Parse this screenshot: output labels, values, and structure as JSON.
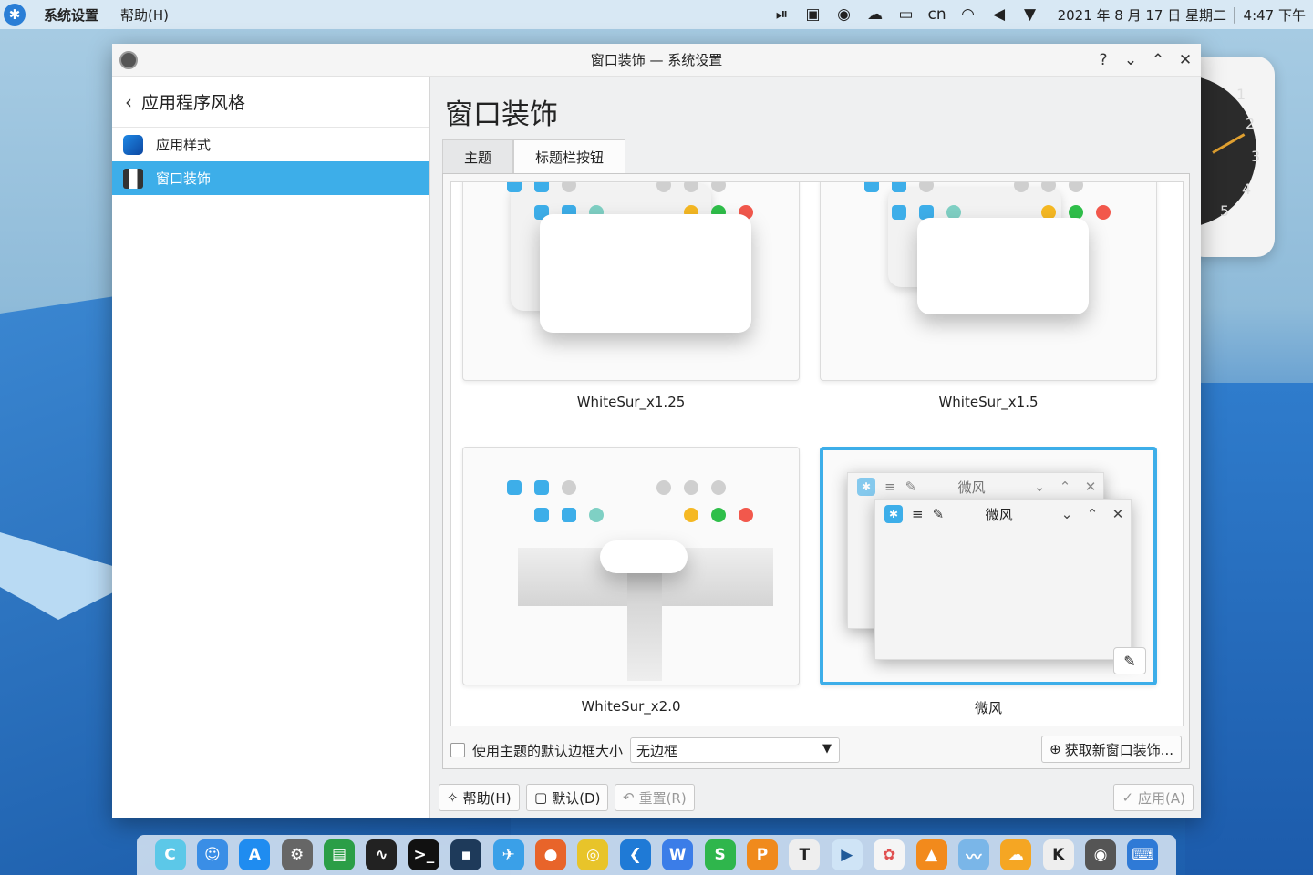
{
  "topbar": {
    "app_name": "系统设置",
    "menu_help": "帮助(H)",
    "lang": "cn",
    "clock": "2021 年 8 月 17 日 星期二 │ 4:47 下午"
  },
  "clock_widget": {
    "numbers": [
      "1",
      "2",
      "3",
      "4",
      "5"
    ]
  },
  "window": {
    "title": "窗口装饰 — 系统设置",
    "help_btn": "?",
    "min_btn": "⌄",
    "max_btn": "⌃",
    "close_btn": "✕"
  },
  "sidebar": {
    "back_label": "应用程序风格",
    "items": [
      {
        "label": "应用样式",
        "active": false
      },
      {
        "label": "窗口装饰",
        "active": true
      }
    ]
  },
  "main": {
    "page_title": "窗口装饰",
    "tabs": [
      {
        "label": "主题",
        "active": false
      },
      {
        "label": "标题栏按钮",
        "active": true
      }
    ],
    "themes": [
      {
        "name": "WhiteSur_x1.25",
        "selected": false
      },
      {
        "name": "WhiteSur_x1.5",
        "selected": false
      },
      {
        "name": "WhiteSur_x2.0",
        "selected": false
      },
      {
        "name": "微风",
        "selected": true
      }
    ],
    "breeze_preview_title": "微风",
    "border_checkbox_label": "使用主题的默认边框大小",
    "border_size_value": "无边框",
    "get_new_label": "获取新窗口装饰..."
  },
  "bottom_buttons": {
    "help": "帮助(H)",
    "defaults": "默认(D)",
    "reset": "重置(R)",
    "apply": "应用(A)"
  },
  "dock": {
    "items": [
      "launcher",
      "finder",
      "app-store",
      "system-settings",
      "task-manager",
      "system-monitor",
      "terminal",
      "konsole",
      "feishu",
      "firefox",
      "chrome",
      "vscode",
      "wps-writer",
      "wps-sheets",
      "wps-presentation",
      "typora",
      "kdenlive",
      "photos",
      "vlc",
      "kingfisher",
      "weather",
      "kvantum",
      "screenshot",
      "keyboard"
    ]
  }
}
